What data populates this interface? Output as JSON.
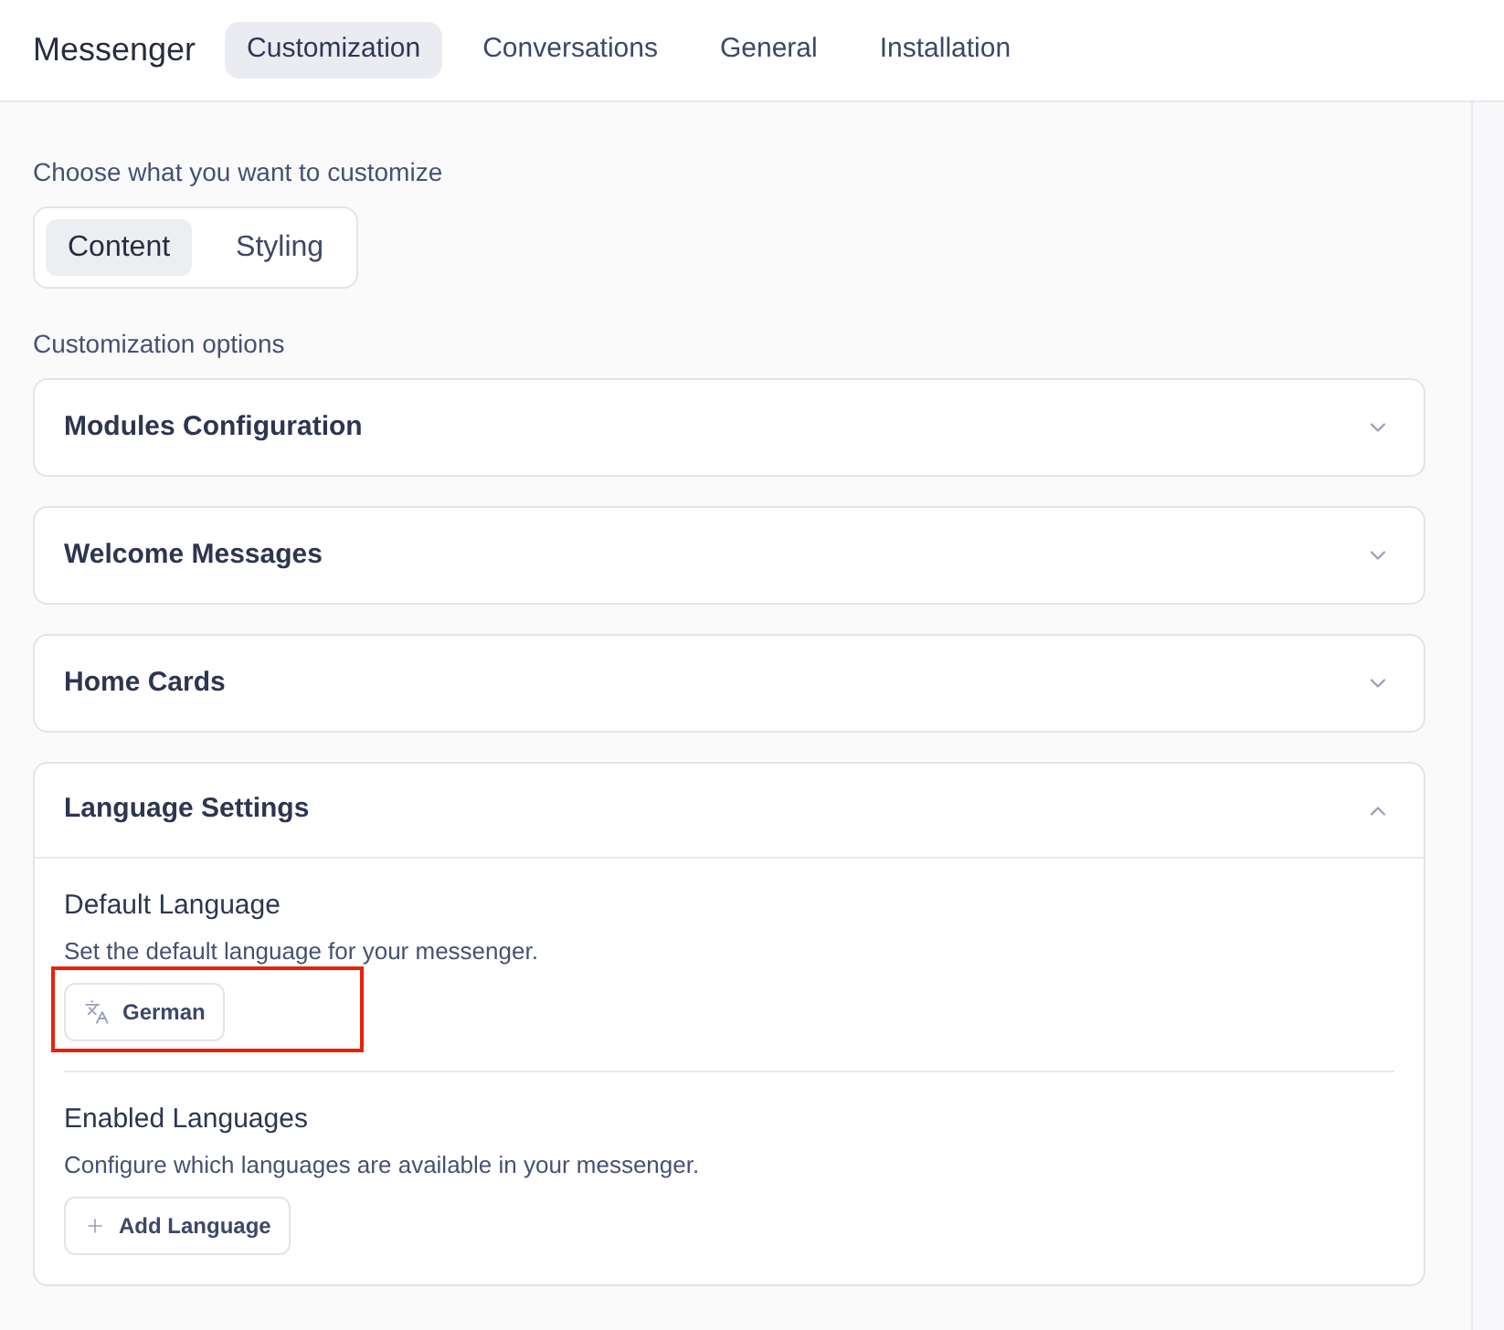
{
  "header": {
    "title": "Messenger",
    "tabs": [
      {
        "label": "Customization",
        "selected": true
      },
      {
        "label": "Conversations",
        "selected": false
      },
      {
        "label": "General",
        "selected": false
      },
      {
        "label": "Installation",
        "selected": false
      }
    ]
  },
  "content": {
    "prompt": "Choose what you want to customize",
    "modes": [
      {
        "label": "Content",
        "selected": true
      },
      {
        "label": "Styling",
        "selected": false
      }
    ],
    "section_label": "Customization options",
    "accordions": [
      {
        "title": "Modules Configuration",
        "expanded": false
      },
      {
        "title": "Welcome Messages",
        "expanded": false
      },
      {
        "title": "Home Cards",
        "expanded": false
      },
      {
        "title": "Language Settings",
        "expanded": true,
        "settings": [
          {
            "title": "Default Language",
            "description": "Set the default language for your messenger.",
            "button": {
              "kind": "language",
              "label": "German"
            },
            "highlighted": true
          },
          {
            "title": "Enabled Languages",
            "description": "Configure which languages are available in your messenger.",
            "button": {
              "kind": "add",
              "label": "Add Language"
            },
            "highlighted": false
          }
        ]
      }
    ]
  }
}
